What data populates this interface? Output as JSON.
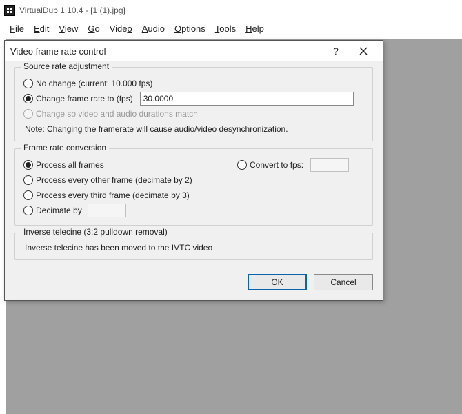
{
  "titlebar": {
    "title": "VirtualDub 1.10.4 - [1 (1).jpg]"
  },
  "menubar": {
    "file": "File",
    "edit": "Edit",
    "view": "View",
    "go": "Go",
    "video": "Video",
    "audio": "Audio",
    "options": "Options",
    "tools": "Tools",
    "help": "Help"
  },
  "dialog": {
    "title": "Video frame rate control",
    "help_symbol": "?",
    "group_source": {
      "legend": "Source rate adjustment",
      "no_change": "No change (current: 10.000 fps)",
      "change_to": "Change frame rate to (fps)",
      "change_to_value": "30.0000",
      "match_av": "Change so video and audio durations match",
      "note": "Note: Changing the framerate will cause audio/video desynchronization."
    },
    "group_conv": {
      "legend": "Frame rate conversion",
      "process_all": "Process all frames",
      "decimate2": "Process every other frame (decimate by 2)",
      "decimate3": "Process every third frame (decimate by 3)",
      "decimate_by": "Decimate by",
      "decimate_value": "",
      "convert_to": "Convert to fps:",
      "convert_value": ""
    },
    "group_ivtc": {
      "legend": "Inverse telecine (3:2 pulldown removal)",
      "msg": "Inverse telecine has been moved to the IVTC video"
    },
    "buttons": {
      "ok": "OK",
      "cancel": "Cancel"
    }
  }
}
